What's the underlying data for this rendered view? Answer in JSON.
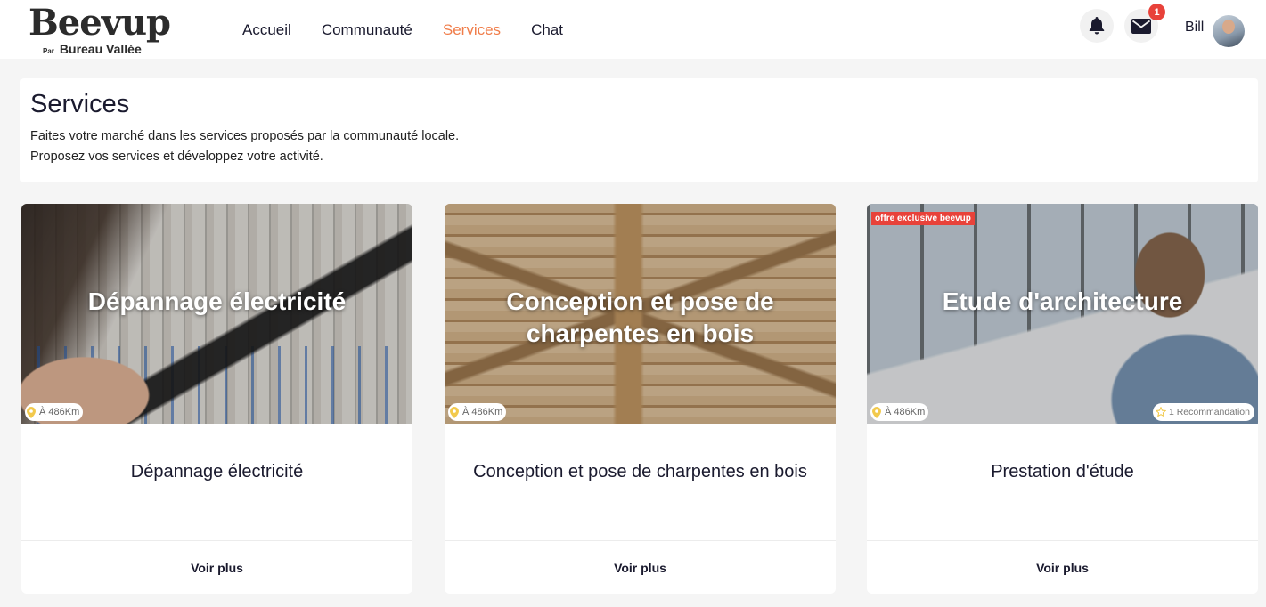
{
  "brand": {
    "name": "Beevup",
    "sub_prefix": "Par",
    "sub": "Bureau Vallée"
  },
  "nav": [
    {
      "label": "Accueil",
      "active": false
    },
    {
      "label": "Communauté",
      "active": false
    },
    {
      "label": "Services",
      "active": true
    },
    {
      "label": "Chat",
      "active": false
    }
  ],
  "header_icons": {
    "bell": "bell-icon",
    "mail": "envelope-icon",
    "mail_badge": "1"
  },
  "user": {
    "name": "Bill"
  },
  "page": {
    "title": "Services",
    "line1": "Faites votre marché dans les services proposés par la communauté locale.",
    "line2": "Proposez vos services et développez votre activité."
  },
  "cards": [
    {
      "image_title": "Dépannage électricité",
      "distance": "À 486Km",
      "title": "Dépannage électricité",
      "cta": "Voir plus"
    },
    {
      "image_title": "Conception et pose de charpentes en bois",
      "distance": "À 486Km",
      "title": "Conception et pose de charpentes en bois",
      "cta": "Voir plus"
    },
    {
      "image_title": "Etude d'architecture",
      "distance": "À 486Km",
      "exclusive": "offre exclusive beevup",
      "recommendation": "1 Recommandation",
      "title": "Prestation d'étude",
      "cta": "Voir plus"
    }
  ],
  "colors": {
    "accent": "#f07d4a",
    "badge": "#e8423a",
    "pin": "#f2c94c"
  }
}
